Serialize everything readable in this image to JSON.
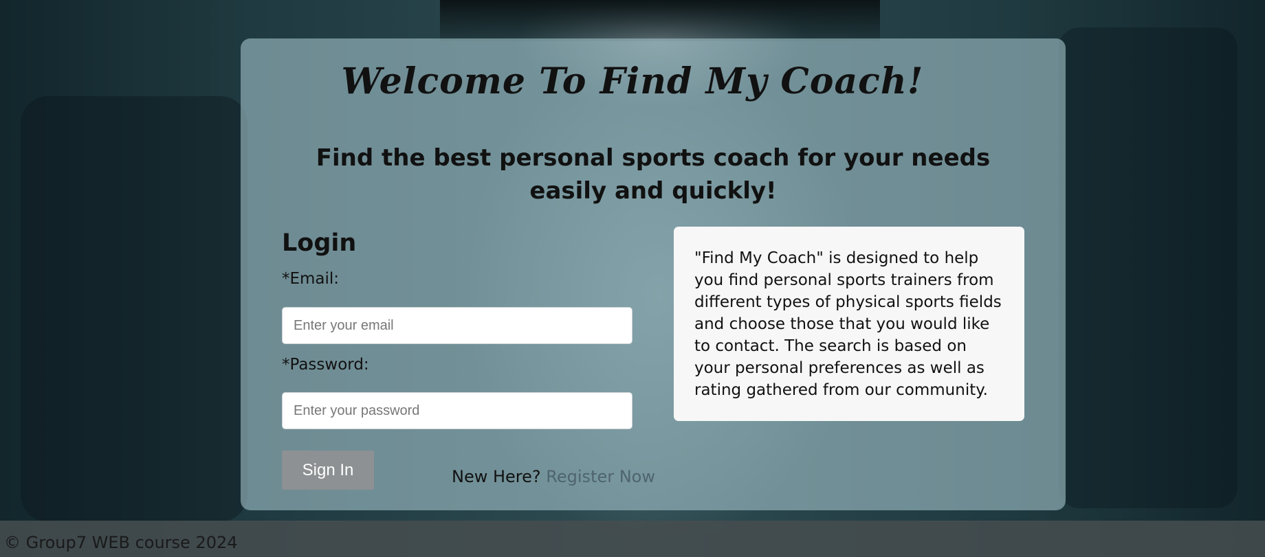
{
  "page": {
    "title": "Welcome To Find My Coach!",
    "subtitle": "Find the best personal sports coach for your needs easily and quickly!"
  },
  "login": {
    "heading": "Login",
    "email_label": "*Email:",
    "email_placeholder": "Enter your email",
    "email_value": "",
    "password_label": "*Password:",
    "password_placeholder": "Enter your password",
    "password_value": "",
    "signin_label": "Sign In",
    "new_here_text": "New Here?",
    "register_label": "Register Now"
  },
  "info": {
    "text": "\"Find My Coach\" is designed to help you find personal sports trainers from different types of physical sports fields and choose those that you would like to contact. The search is based on your personal preferences as well as rating gathered from our community."
  },
  "footer": {
    "text": "© Group7 WEB course 2024"
  },
  "colors": {
    "card_bg": "#a0bec6",
    "signin_bg": "#8d9193",
    "link": "#4f6470",
    "footer_bg": "#464e50"
  }
}
